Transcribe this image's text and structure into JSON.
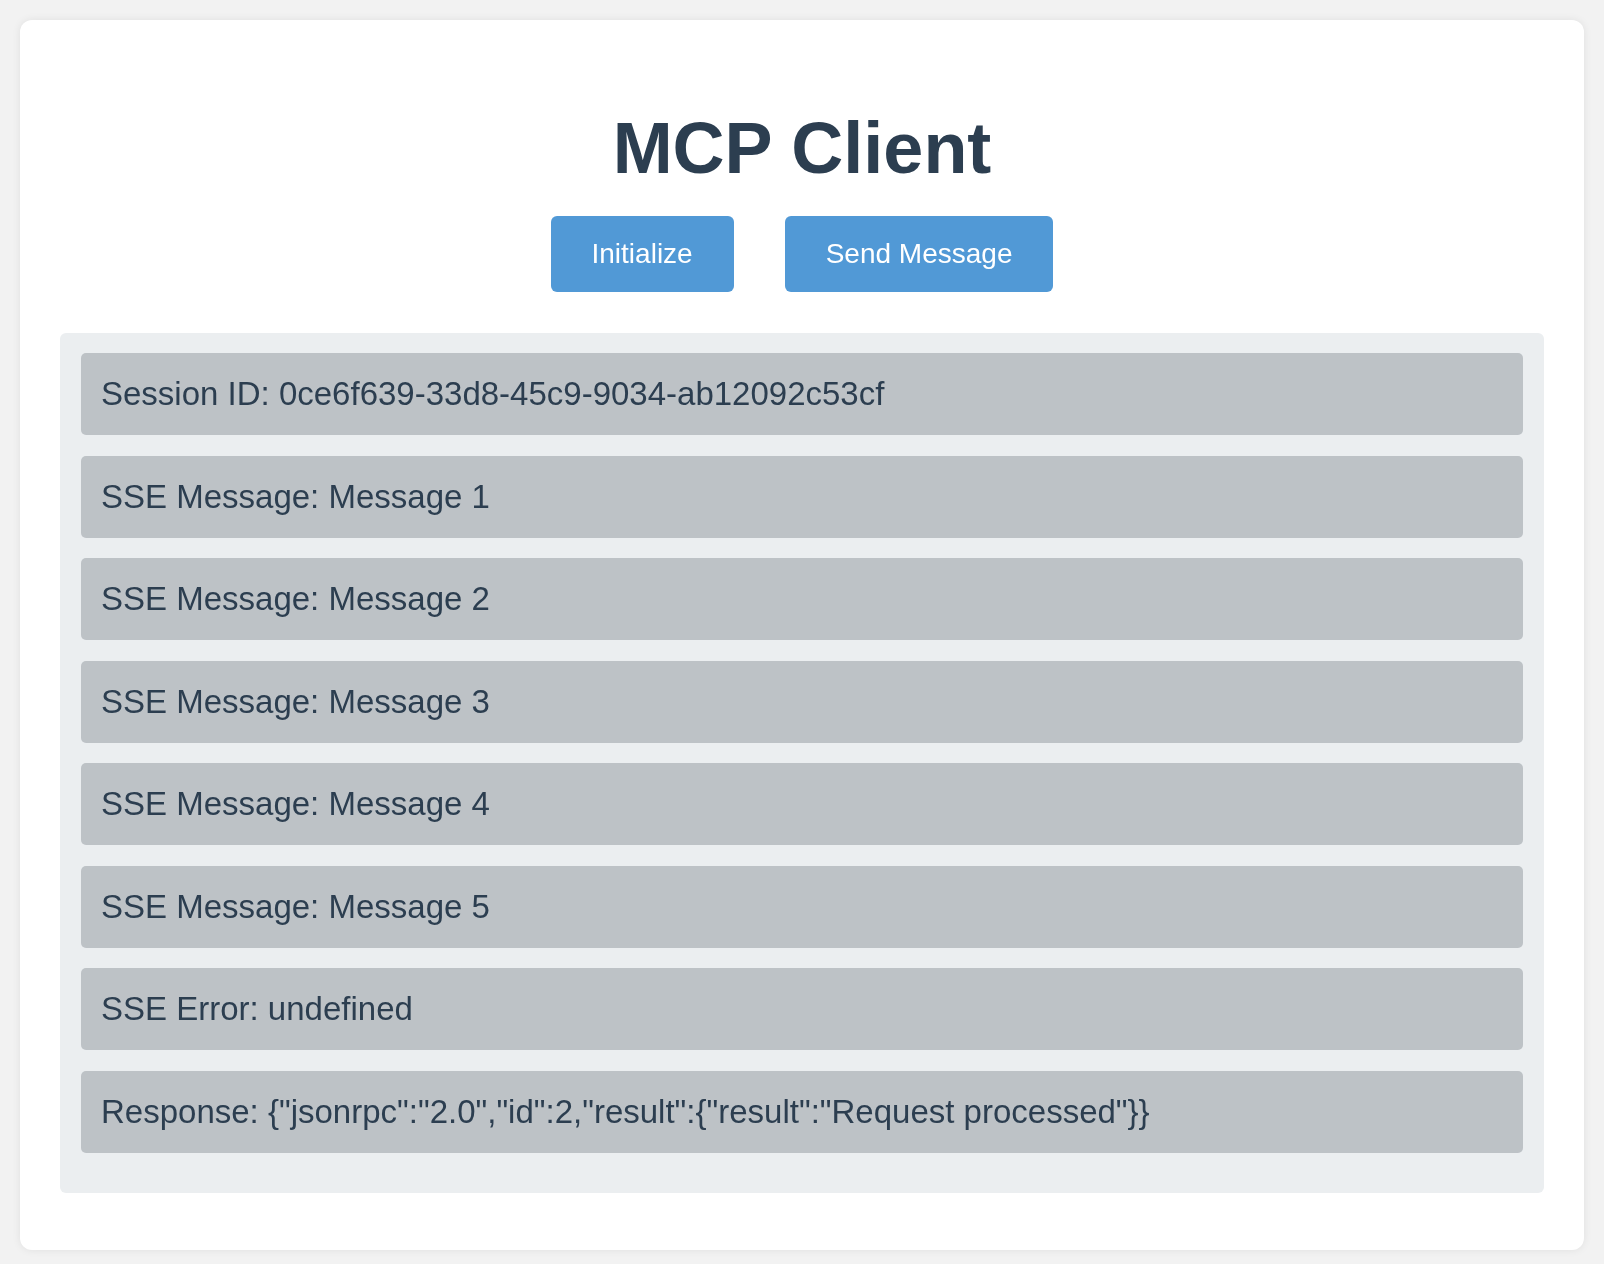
{
  "title": "MCP Client",
  "buttons": [
    "Initialize",
    "Send Message"
  ],
  "log": [
    "Session ID: 0ce6f639-33d8-45c9-9034-ab12092c53cf",
    "SSE Message: Message 1",
    "SSE Message: Message 2",
    "SSE Message: Message 3",
    "SSE Message: Message 4",
    "SSE Message: Message 5",
    "SSE Error: undefined",
    "Response: {\"jsonrpc\":\"2.0\",\"id\":2,\"result\":{\"result\":\"Request processed\"}}"
  ]
}
